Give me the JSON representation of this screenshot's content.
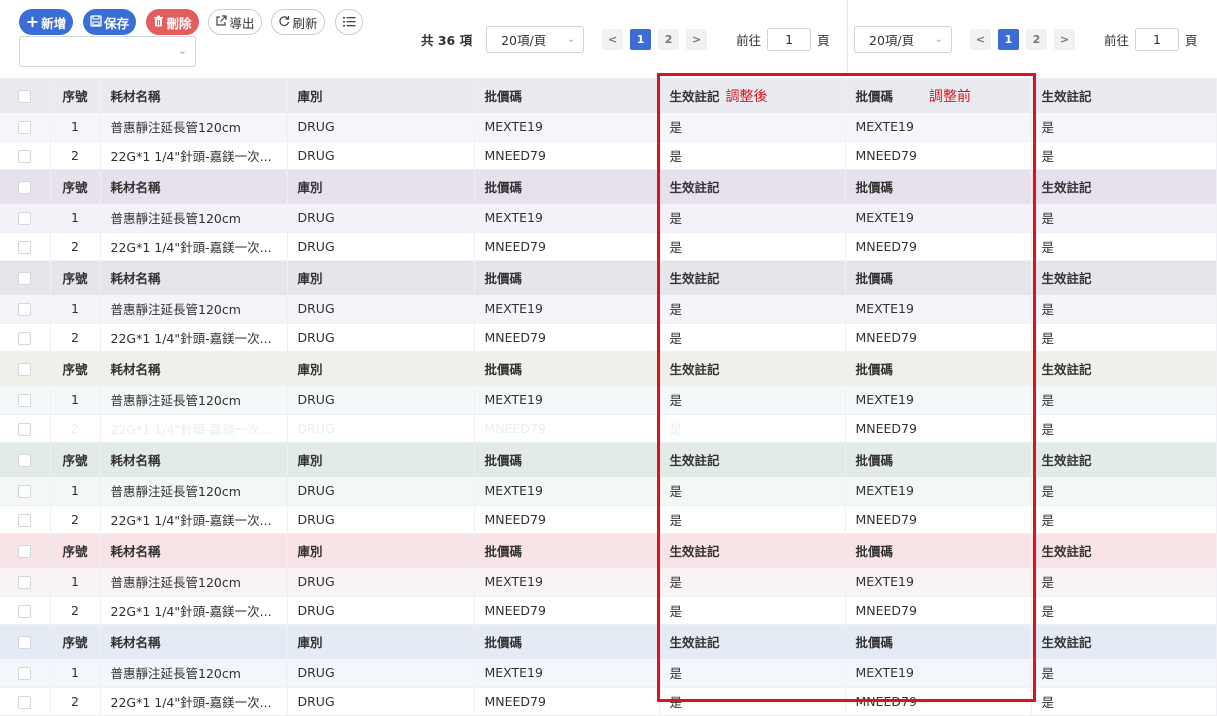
{
  "toolbar": {
    "add_label": "新增",
    "save_label": "保存",
    "delete_label": "刪除",
    "export_label": "導出",
    "refresh_label": "刷新",
    "add_icon": "plus-icon",
    "save_icon": "floppy-icon",
    "delete_icon": "trash-icon",
    "export_icon": "external-link-icon",
    "refresh_icon": "refresh-icon",
    "list_icon": "list-settings-icon"
  },
  "pager_left": {
    "total": "共 36 項",
    "page_size": "20項/頁",
    "pages": [
      "1",
      "2"
    ],
    "goto_label": "前往",
    "goto_value": "1",
    "page_suffix": "頁"
  },
  "pager_right": {
    "page_size": "20項/頁",
    "pages": [
      "1",
      "2"
    ],
    "goto_label": "前往",
    "goto_value": "1",
    "page_suffix": "頁"
  },
  "columns": {
    "no": "序號",
    "name": "耗材名稱",
    "store": "庫別",
    "code": "批價碼",
    "effective": "生效註記",
    "code2": "批價碼",
    "effective2": "生效註記"
  },
  "annotations": {
    "after": "調整後",
    "before": "調整前"
  },
  "rows": [
    {
      "no": "1",
      "name": "普惠靜注延長管120cm",
      "store": "DRUG",
      "code": "MEXTE19",
      "effective": "是",
      "code2": "MEXTE19",
      "effective2": "是"
    },
    {
      "no": "2",
      "name": "22G*1 1/4\"針頭-嘉鎂一次...",
      "store": "DRUG",
      "code": "MNEED79",
      "effective": "是",
      "code2": "MNEED79",
      "effective2": "是"
    }
  ],
  "colors": {
    "primary": "#3a6ed6",
    "danger": "#e45c5c",
    "frame": "#e0111d",
    "theme_heads": [
      "#e9ebf0",
      "#e7e1ee",
      "#e4e6ec",
      "#f1efe9",
      "#e2ebe8",
      "#f8e3e6",
      "#e4ebf4"
    ],
    "theme_rows": [
      "#f5f6f9",
      "#f4f2f8",
      "#f4f5fa",
      "#f2f9f8",
      "#f3f8f6",
      "#faf3f5",
      "#f3f6fb"
    ]
  }
}
